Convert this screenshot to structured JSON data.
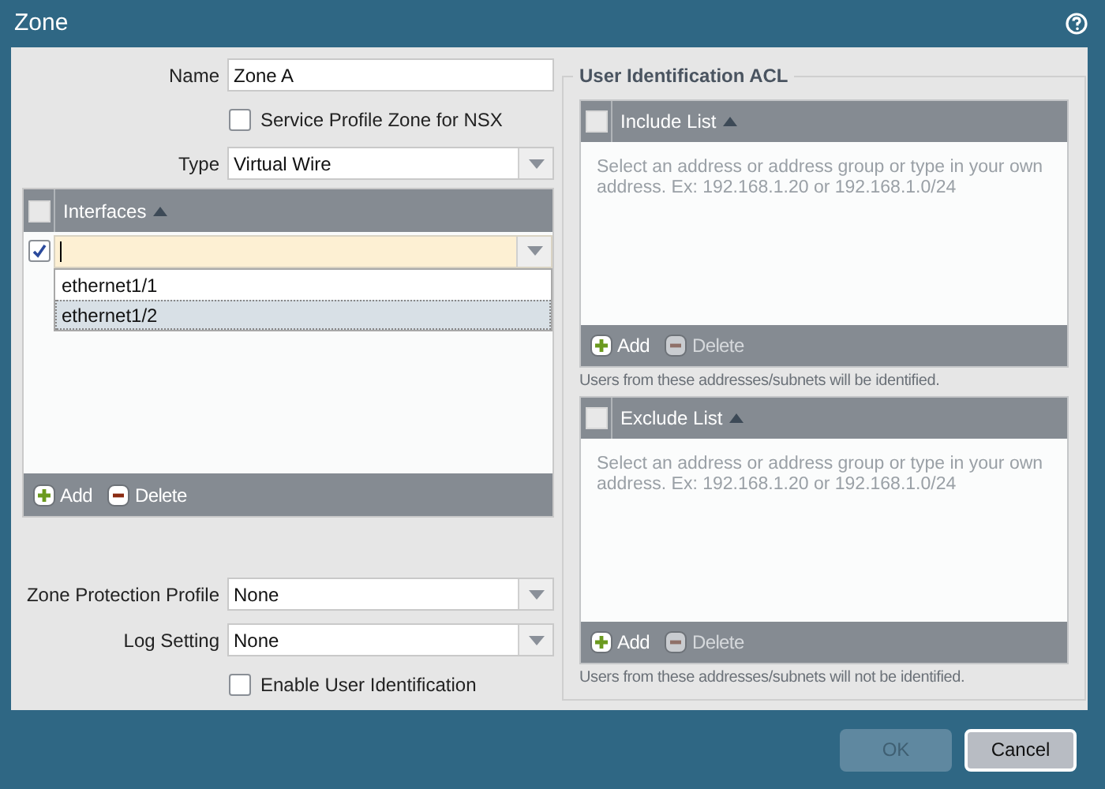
{
  "window": {
    "title": "Zone"
  },
  "name": {
    "label": "Name",
    "value": "Zone A"
  },
  "service_profile": {
    "label": "Service Profile Zone for NSX",
    "checked": false
  },
  "type": {
    "label": "Type",
    "value": "Virtual Wire"
  },
  "interfaces": {
    "header": "Interfaces",
    "header_checked": false,
    "edit_row": {
      "checked": true
    },
    "dropdown_options": [
      {
        "label": "ethernet1/1",
        "selected": false
      },
      {
        "label": "ethernet1/2",
        "selected": true
      }
    ],
    "actions": [
      {
        "kind": "add",
        "label": "Add",
        "disabled": false
      },
      {
        "kind": "delete",
        "label": "Delete",
        "disabled": false
      }
    ]
  },
  "zone_protection_profile": {
    "label": "Zone Protection Profile",
    "value": "None"
  },
  "log_setting": {
    "label": "Log Setting",
    "value": "None"
  },
  "enable_user_identification": {
    "label": "Enable User Identification",
    "checked": false
  },
  "acl": {
    "title": "User Identification ACL",
    "lists": [
      {
        "header": "Include List",
        "header_checked": false,
        "hint": "Select an address or address group or type in your own address. Ex: 192.168.1.20 or 192.168.1.0/24",
        "actions": [
          {
            "kind": "add",
            "label": "Add",
            "disabled": false
          },
          {
            "kind": "delete",
            "label": "Delete",
            "disabled": true
          }
        ],
        "note": "Users from these addresses/subnets will be identified."
      },
      {
        "header": "Exclude List",
        "header_checked": false,
        "hint": "Select an address or address group or type in your own address. Ex: 192.168.1.20 or 192.168.1.0/24",
        "actions": [
          {
            "kind": "add",
            "label": "Add",
            "disabled": false
          },
          {
            "kind": "delete",
            "label": "Delete",
            "disabled": true
          }
        ],
        "note": "Users from these addresses/subnets will not be identified."
      }
    ]
  },
  "buttons": [
    {
      "label": "OK",
      "disabled": true
    },
    {
      "label": "Cancel",
      "disabled": false
    }
  ]
}
